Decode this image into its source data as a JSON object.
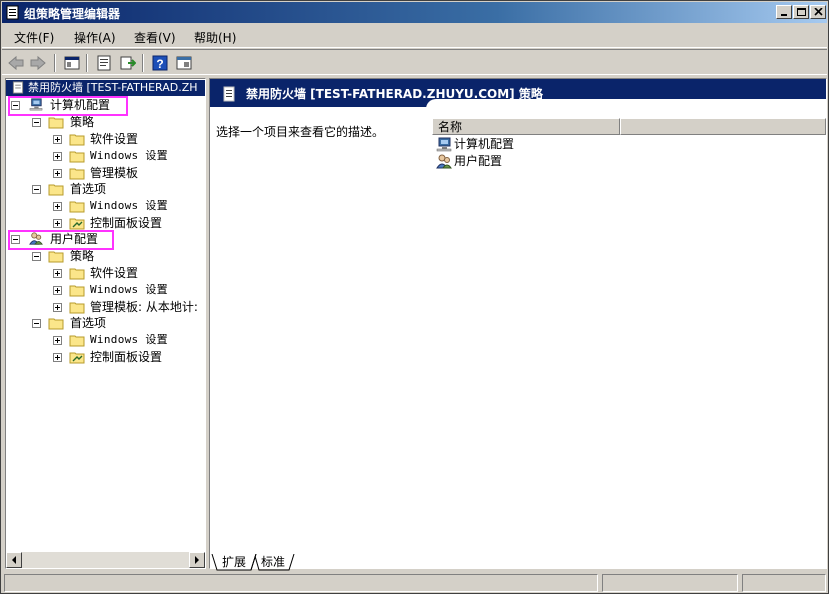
{
  "window": {
    "title": "组策略管理编辑器",
    "buttons": {
      "minimize": "minimize-icon",
      "maximize": "maximize-icon",
      "close": "close-icon"
    }
  },
  "menu": [
    {
      "label": "文件(F)"
    },
    {
      "label": "操作(A)"
    },
    {
      "label": "查看(V)"
    },
    {
      "label": "帮助(H)"
    }
  ],
  "toolbar": {
    "icons": [
      "back-arrow-icon",
      "forward-arrow-icon",
      "show-hide-tree-icon",
      "properties-icon",
      "export-list-icon",
      "help-icon",
      "console-view-icon"
    ]
  },
  "tree": {
    "root": "禁用防火墙 [TEST-FATHERAD.ZH",
    "computer_config": "计算机配置",
    "user_config": "用户配置",
    "policies": "策略",
    "software_settings": "软件设置",
    "windows_settings": "Windows 设置",
    "admin_templates": "管理模板",
    "admin_templates_user": "管理模板: 从本地计:",
    "preferences": "首选项",
    "control_panel": "控制面板设置"
  },
  "right": {
    "header_title": "禁用防火墙 [TEST-FATHERAD.ZHUYU.COM] 策略",
    "description": "选择一个项目来查看它的描述。",
    "column_name": "名称",
    "items": [
      "计算机配置",
      "用户配置"
    ]
  },
  "tabs": [
    {
      "label": "扩展"
    },
    {
      "label": "标准"
    }
  ],
  "colors": {
    "selection": "#0a246a",
    "highlight_box": "#ff33ff",
    "chrome": "#d4d0c8"
  }
}
